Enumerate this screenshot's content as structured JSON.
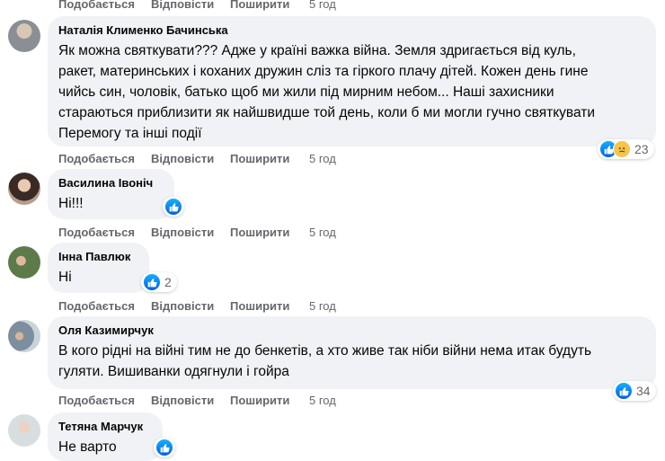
{
  "comments": [
    {
      "author": "Наталія Клименко Бачинська",
      "lines": [
        "Як можна святкувати??? Адже у країні важка війна. Земля здригається від куль,",
        "ракет, материнських і коханих дружин сліз та гіркого плачу дітей. Кожен день гине",
        "чийсь син, чоловік, батько щоб ми жили під мирним небом... Наші захисники",
        "стараються приблизити як найшвидше той день, коли б ми могли гучно святкувати",
        "Перемогу та інші події"
      ],
      "reactions": [
        "like-icon",
        "sad-icon"
      ],
      "reaction_count": "23",
      "time": "5 год"
    },
    {
      "author": "Василина Івоніч",
      "text": "Ні!!!",
      "reactions": [
        "like-icon"
      ],
      "reaction_count": "",
      "time": "5 год"
    },
    {
      "author": "Інна Павлюк",
      "text": "Ні",
      "reactions": [
        "like-icon"
      ],
      "reaction_count": "2",
      "time": "5 год"
    },
    {
      "author": "Оля Казимирчук",
      "lines": [
        "В кого рідні на війні тим не до бенкетів, а хто живе так ніби війни нема итак будуть",
        "гуляти. Вишиванки одягнули і гойра"
      ],
      "reactions": [
        "like-icon"
      ],
      "reaction_count": "34",
      "time": "5 год"
    },
    {
      "author": "Тетяна Марчук",
      "text": "Не варто",
      "reactions": [
        "like-icon"
      ],
      "reaction_count": "",
      "time": ""
    }
  ],
  "actions": {
    "like": "Подобається",
    "reply": "Відповісти",
    "share": "Поширити",
    "top_time": "5 год"
  },
  "colors": {
    "bubble": "#f0f2f5",
    "like_blue": "#1877f2",
    "muted": "#65676b"
  }
}
